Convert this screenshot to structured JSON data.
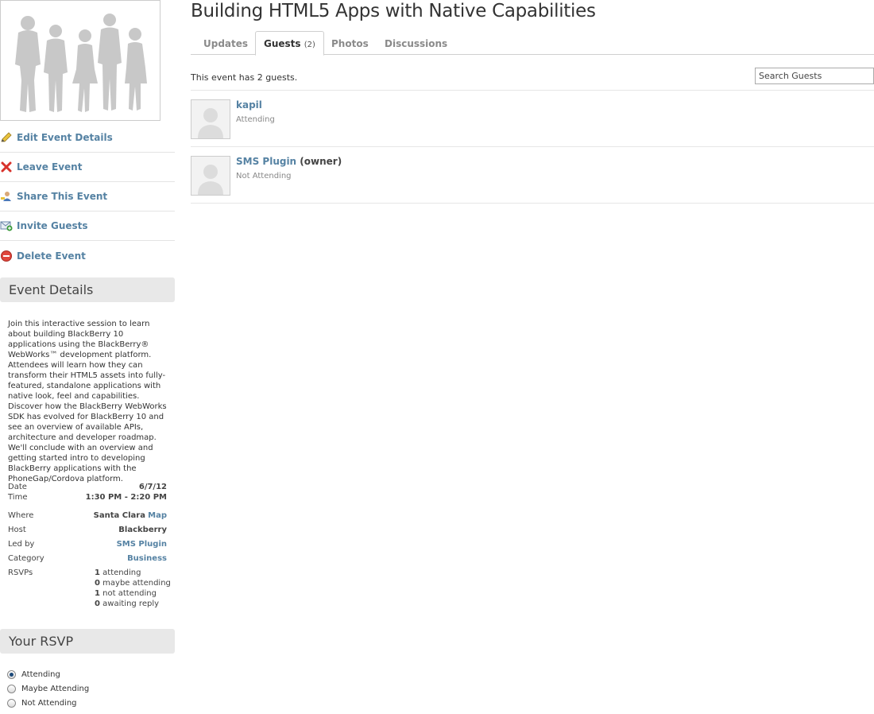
{
  "page": {
    "title": "Building HTML5 Apps with Native Capabilities"
  },
  "sidebar": {
    "actions": [
      {
        "label": "Edit Event Details",
        "icon": "pencil-icon"
      },
      {
        "label": "Leave Event",
        "icon": "red-x-icon"
      },
      {
        "label": "Share This Event",
        "icon": "share-person-icon"
      },
      {
        "label": "Invite Guests",
        "icon": "envelope-plus-icon"
      },
      {
        "label": "Delete Event",
        "icon": "delete-circle-icon"
      }
    ],
    "event_details": {
      "header": "Event Details",
      "description": "Join this interactive session to learn about building BlackBerry 10 applications using the BlackBerry® WebWorks™ development platform. Attendees will learn how they can transform their HTML5 assets into fully-featured, standalone applications with native look, feel and capabilities. Discover how the BlackBerry WebWorks SDK has evolved for BlackBerry 10 and see an overview of available APIs, architecture and developer roadmap. We'll conclude with an overview and getting started intro to developing BlackBerry applications with the PhoneGap/Cordova platform.",
      "date_label": "Date",
      "date_value": "6/7/12",
      "time_label": "Time",
      "time_value": "1:30 PM - 2:20 PM",
      "where_label": "Where",
      "where_value": "Santa Clara",
      "map_link": "Map",
      "host_label": "Host",
      "host_value": "Blackberry",
      "ledby_label": "Led by",
      "ledby_value": "SMS Plugin",
      "category_label": "Category",
      "category_value": "Business",
      "rsvps_label": "RSVPs",
      "rsvp_counts": [
        {
          "count": "1",
          "label": "attending"
        },
        {
          "count": "0",
          "label": "maybe attending"
        },
        {
          "count": "1",
          "label": "not attending"
        },
        {
          "count": "0",
          "label": "awaiting reply"
        }
      ]
    },
    "your_rsvp": {
      "header": "Your RSVP",
      "options": [
        "Attending",
        "Maybe Attending",
        "Not Attending"
      ],
      "selected": "Attending"
    }
  },
  "tabs": [
    {
      "label": "Updates",
      "count": ""
    },
    {
      "label": "Guests",
      "count": "(2)"
    },
    {
      "label": "Photos",
      "count": ""
    },
    {
      "label": "Discussions",
      "count": ""
    }
  ],
  "active_tab": "Guests",
  "guests": {
    "summary": "This event has 2 guests.",
    "search_placeholder": "Search Guests",
    "list": [
      {
        "name": "kapil",
        "role": "",
        "status": "Attending"
      },
      {
        "name": "SMS Plugin",
        "role": "(owner)",
        "status": "Not Attending"
      }
    ]
  },
  "colors": {
    "link": "#5582a3",
    "panel_header_bg": "#e8e8e8"
  }
}
